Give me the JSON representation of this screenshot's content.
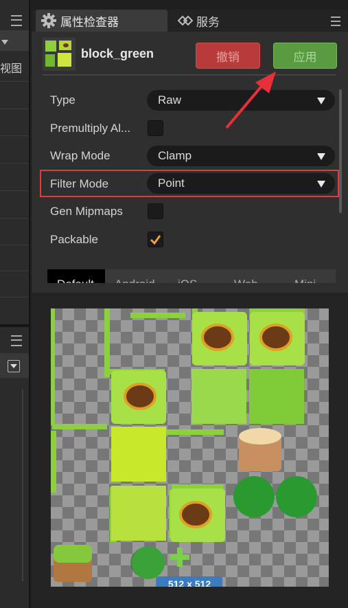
{
  "left_panel": {
    "fragment_label": "视图"
  },
  "tabs": [
    {
      "label": "属性检查器",
      "icon": "gear-icon"
    },
    {
      "label": "服务",
      "icon": "link-icon"
    }
  ],
  "asset": {
    "name": "block_green"
  },
  "buttons": {
    "revert": "撤销",
    "apply": "应用"
  },
  "properties": {
    "type": {
      "label": "Type",
      "value": "Raw"
    },
    "premultiply": {
      "label": "Premultiply Al...",
      "checked": false
    },
    "wrap_mode": {
      "label": "Wrap Mode",
      "value": "Clamp"
    },
    "filter_mode": {
      "label": "Filter Mode",
      "value": "Point"
    },
    "gen_mipmaps": {
      "label": "Gen Mipmaps",
      "checked": false
    },
    "packable": {
      "label": "Packable",
      "checked": true
    }
  },
  "platform_tabs": [
    "Default",
    "Android",
    "iOS",
    "Web",
    "Mini"
  ],
  "preview": {
    "size_badge": "512 x 512"
  },
  "colors": {
    "accent_red": "#e03c3c",
    "revert_bg": "#b83a3a",
    "apply_bg": "#5a9b42",
    "check_orange": "#f0a030",
    "badge_blue": "#3b7bbf"
  }
}
